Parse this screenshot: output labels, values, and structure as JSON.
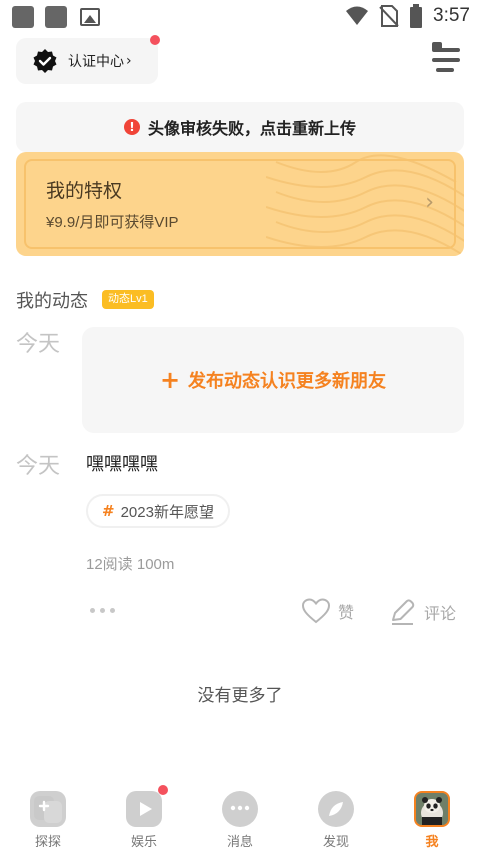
{
  "status_bar": {
    "time": "3:57",
    "icons": [
      "notification-square-icon",
      "notification-square-icon",
      "image-icon",
      "wifi-icon",
      "no-sim-icon",
      "battery-icon"
    ]
  },
  "header": {
    "cert_label": "认证中心",
    "cert_arrow": "›",
    "menu_icon": "menu-icon"
  },
  "alert": {
    "icon_glyph": "!",
    "text": "头像审核失败，点击重新上传"
  },
  "privilege": {
    "title": "我的特权",
    "subtitle": "¥9.9/月即可获得VIP",
    "arrow": "›"
  },
  "moments": {
    "title": "我的动态",
    "level_badge": "动态Lv1",
    "day_label_1": "今天",
    "post_prompt": "发布动态认识更多新朋友",
    "post_plus": "+",
    "day_label_2": "今天",
    "post": {
      "text": "嘿嘿嘿嘿",
      "tag_hash": "#",
      "tag": "2023新年愿望",
      "meta": "12阅读 100m",
      "like_label": "赞",
      "comment_label": "评论"
    },
    "no_more": "没有更多了"
  },
  "tabbar": {
    "tabs": [
      {
        "label": "探探",
        "icon": "explore-icon"
      },
      {
        "label": "娱乐",
        "icon": "play-icon"
      },
      {
        "label": "消息",
        "icon": "chat-icon"
      },
      {
        "label": "发现",
        "icon": "compass-icon"
      },
      {
        "label": "我",
        "icon": "avatar"
      }
    ]
  },
  "colors": {
    "accent": "#f58220",
    "badge": "#fbbd23",
    "privilege_bg": "#fdd48c",
    "alert_red": "#f04438",
    "notify_dot": "#f4515d"
  }
}
